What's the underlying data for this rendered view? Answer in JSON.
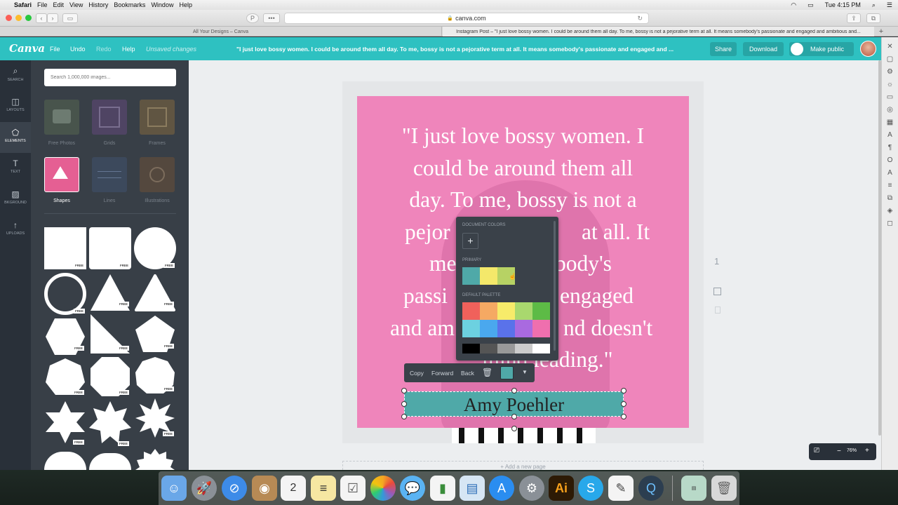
{
  "menubar": {
    "apple": "",
    "app": "Safari",
    "items": [
      "File",
      "Edit",
      "View",
      "History",
      "Bookmarks",
      "Window",
      "Help"
    ],
    "clock": "Tue 4:15 PM"
  },
  "browser": {
    "url": "canva.com",
    "tabs": [
      "All Your Designs – Canva",
      "Instagram Post – \"I just love bossy women. I could be around them all day. To me, bossy is not a pejorative term at all. It means somebody's passionate and engaged and ambitious and..."
    ]
  },
  "header": {
    "logo": "Canva",
    "menu": [
      "File",
      "Undo",
      "Redo",
      "Help"
    ],
    "status": "Unsaved changes",
    "title": "\"I just love bossy women. I could be around them all day. To me, bossy is not a pejorative term at all. It means somebody's passionate and engaged and ...",
    "share": "Share",
    "download": "Download",
    "make_public": "Make public"
  },
  "rail": [
    {
      "label": "SEARCH",
      "icon": "search-icon"
    },
    {
      "label": "LAYOUTS",
      "icon": "layouts-icon"
    },
    {
      "label": "ELEMENTS",
      "icon": "elements-icon"
    },
    {
      "label": "TEXT",
      "icon": "text-icon"
    },
    {
      "label": "BKGROUND",
      "icon": "background-icon"
    },
    {
      "label": "UPLOADS",
      "icon": "uploads-icon"
    }
  ],
  "panel": {
    "search_placeholder": "Search 1,000,000 images...",
    "categories": [
      "Free Photos",
      "Grids",
      "Frames",
      "Shapes",
      "Lines",
      "Illustrations"
    ],
    "free_tag": "FREE"
  },
  "design": {
    "quote": "\"I just love bossy women. I could be around them all day. To me, bossy is not a pejorative term at all. It means somebody's passionate and engaged and ambitious and doesn't mind leading.\"",
    "quote_lines": [
      "\"I just love bossy women. I",
      "could be around them all",
      "day. To me, bossy is not a",
      "pejor",
      "at all. It",
      "me",
      "body's",
      "passi",
      "engaged",
      "and am",
      "nd doesn't",
      "mind leading.\""
    ],
    "author": "Amy Poehler",
    "page_number": "1",
    "add_page": "+ Add a new page",
    "bg_color": "#ef85bb",
    "accent_color": "#4fa9a8"
  },
  "toolbar": {
    "copy": "Copy",
    "forward": "Forward",
    "back": "Back"
  },
  "color_picker": {
    "document_colors": "DOCUMENT COLORS",
    "add": "+",
    "primary": "PRIMARY",
    "primary_colors": [
      "#4fa9a8",
      "#f4e86a",
      "#b7d264"
    ],
    "default_palette": "DEFAULT PALETTE",
    "palette_row1": [
      "#f0615b",
      "#f5a963",
      "#f7eb6a",
      "#a9d86e",
      "#5dbb46"
    ],
    "palette_row2": [
      "#6cd1e0",
      "#4aa8ee",
      "#5a72ea",
      "#a96ae0",
      "#ef6fae"
    ],
    "palette_row3": [
      "#000000",
      "#555555",
      "#999999",
      "#cccccc",
      "#ffffff"
    ]
  },
  "zoom": {
    "minus": "−",
    "value": "76%",
    "plus": "+"
  }
}
